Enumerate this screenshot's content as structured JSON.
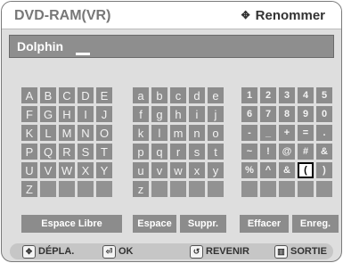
{
  "header": {
    "title": "DVD-RAM(VR)",
    "action_label": "Renommer"
  },
  "name_field": {
    "value": "Dolphin"
  },
  "keyboard": {
    "uppercase": [
      "A",
      "B",
      "C",
      "D",
      "E",
      "F",
      "G",
      "H",
      "I",
      "J",
      "K",
      "L",
      "M",
      "N",
      "O",
      "P",
      "Q",
      "R",
      "S",
      "T",
      "U",
      "V",
      "W",
      "X",
      "Y",
      "Z",
      "",
      "",
      "",
      ""
    ],
    "lowercase": [
      "a",
      "b",
      "c",
      "d",
      "e",
      "f",
      "g",
      "h",
      "i",
      "j",
      "k",
      "l",
      "m",
      "n",
      "o",
      "p",
      "q",
      "r",
      "s",
      "t",
      "u",
      "v",
      "w",
      "x",
      "y",
      "z",
      "",
      "",
      "",
      ""
    ],
    "symbols": [
      "1",
      "2",
      "3",
      "4",
      "5",
      "6",
      "7",
      "8",
      "9",
      "0",
      "-",
      "_",
      "+",
      "=",
      ".",
      "~",
      "!",
      "@",
      "#",
      "&",
      "%",
      "^",
      "&",
      "(",
      ")",
      "",
      "",
      "",
      "",
      ""
    ],
    "selected_symbol_index": 23
  },
  "buttons": {
    "space_free": "Espace Libre",
    "space": "Espace",
    "delete": "Suppr.",
    "clear": "Effacer",
    "save": "Enreg."
  },
  "footer": {
    "move": "DÉPLA.",
    "ok": "OK",
    "back": "REVENIR",
    "exit": "SORTIE"
  }
}
